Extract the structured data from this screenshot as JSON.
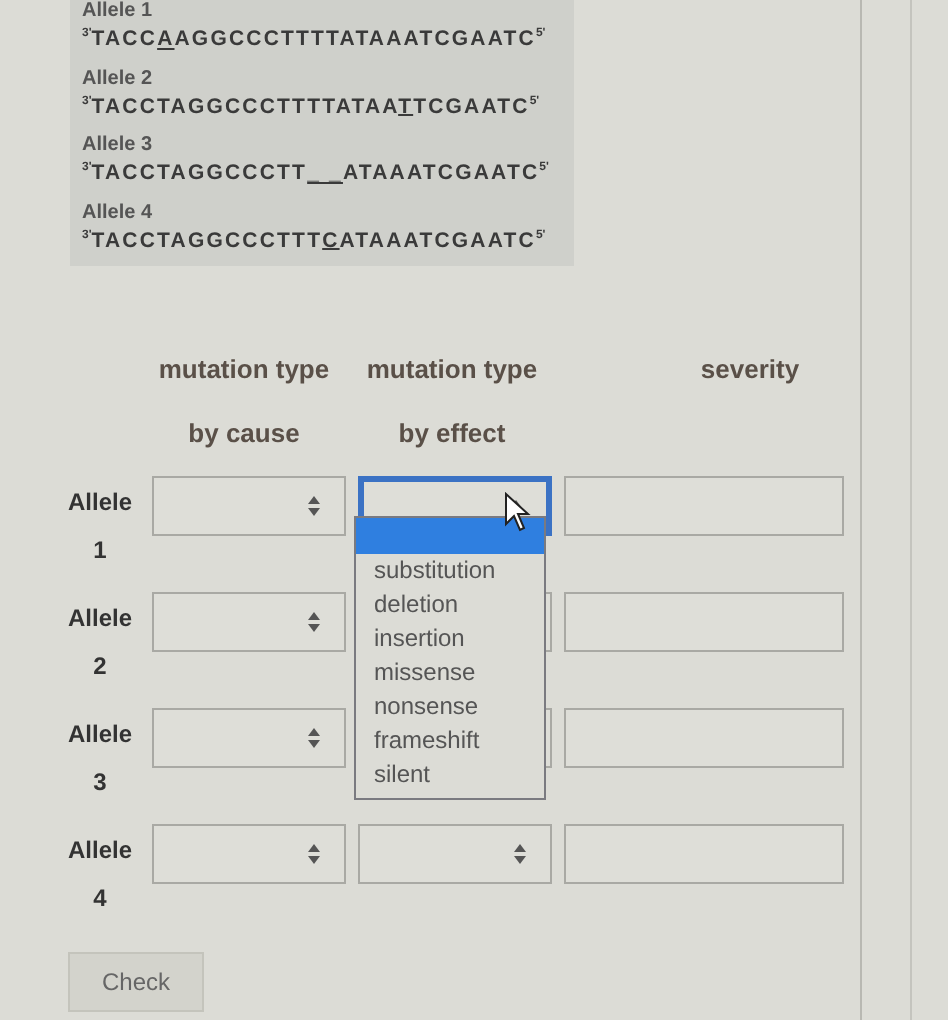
{
  "sequences": [
    {
      "title": "Allele 1",
      "prime_start": "3'",
      "before": "TACC",
      "mark": "A",
      "after": "AGGCCCTTTTATAAATCGAATC",
      "prime_end": "5'"
    },
    {
      "title": "Allele 2",
      "prime_start": "3'",
      "before": "TACCTAGGCCCTTTTATAA",
      "mark": "T",
      "after": "TCGAATC",
      "prime_end": "5'"
    },
    {
      "title": "Allele 3",
      "prime_start": "3'",
      "before": "TACCTAGGCCCTT",
      "mark": "_ _",
      "after": "ATAAATCGAATC",
      "prime_end": "5'"
    },
    {
      "title": "Allele 4",
      "prime_start": "3'",
      "before": "TACCTAGGCCCTTT",
      "mark": "C",
      "after": "ATAAATCGAATC",
      "prime_end": "5'"
    }
  ],
  "columns": [
    {
      "line_1": "mutation type",
      "line_2": "by cause"
    },
    {
      "line_1": "mutation type",
      "line_2": "by effect"
    },
    {
      "line_1": "severity"
    }
  ],
  "rows": [
    {
      "label": "Allele",
      "number": "1",
      "effect_expanded": true
    },
    {
      "label": "Allele",
      "number": "2",
      "effect_expanded": false
    },
    {
      "label": "Allele",
      "number": "3",
      "effect_expanded": false
    },
    {
      "label": "Allele",
      "number": "4",
      "effect_expanded": false
    }
  ],
  "dropdown": {
    "blank_option_highlighted": true,
    "options": [
      "substitution",
      "deletion",
      "insertion",
      "missense",
      "nonsense",
      "frameshift",
      "silent"
    ]
  },
  "check_button": "Check"
}
